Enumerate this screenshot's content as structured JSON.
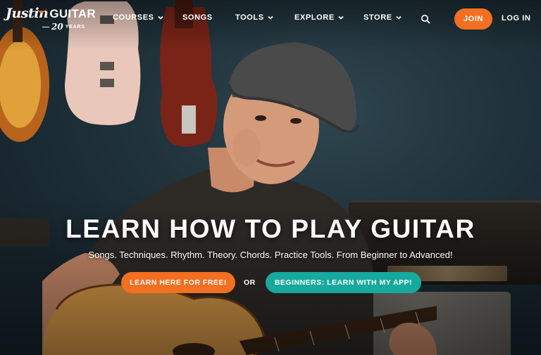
{
  "brand": {
    "logo_script": "Justin",
    "logo_word": "GUITAR",
    "anniversary_number": "20",
    "anniversary_word": "YEARS",
    "accent_color": "#f36f21",
    "teal_color": "#17a99d"
  },
  "nav": {
    "items": [
      {
        "label": "COURSES",
        "dropdown": true
      },
      {
        "label": "SONGS",
        "dropdown": false
      },
      {
        "label": "TOOLS",
        "dropdown": true
      },
      {
        "label": "EXPLORE",
        "dropdown": true
      },
      {
        "label": "STORE",
        "dropdown": true
      }
    ],
    "search_icon": "search-icon",
    "join_label": "JOIN",
    "login_label": "LOG IN"
  },
  "hero": {
    "headline": "LEARN HOW TO PLAY GUITAR",
    "subline": "Songs. Techniques. Rhythm. Theory. Chords. Practice Tools. From Beginner to Advanced!",
    "primary_cta": "LEARN HERE FOR FREE!",
    "separator": "OR",
    "secondary_cta": "BEGINNERS: LEARN WITH MY APP!"
  }
}
